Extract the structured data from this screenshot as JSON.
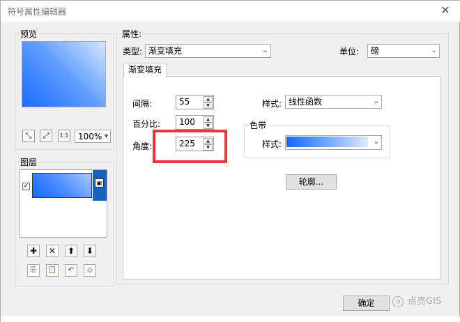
{
  "window": {
    "title": "符号属性编辑器",
    "close_glyph": "✕"
  },
  "preview": {
    "label": "预览",
    "zoom_value": "100%",
    "zoom_arrow": "▾",
    "toolbar": {
      "fit_glyph": "⤡",
      "expand_glyph": "⤢",
      "actual_glyph": "1:1"
    }
  },
  "layers": {
    "label": "图层",
    "check_glyph": "✓",
    "lock_glyph": "▣",
    "buttons": {
      "add_glyph": "✚",
      "remove_glyph": "✕",
      "up_glyph": "⬆",
      "down_glyph": "⬇",
      "copy_glyph": "⎘",
      "paste_glyph": "📋",
      "reset_glyph": "↶",
      "tag_glyph": "◇"
    }
  },
  "properties": {
    "label": "属性:",
    "type_label": "类型:",
    "type_value": "渐变填充",
    "unit_label": "单位:",
    "unit_value": "磅",
    "arrow_glyph": "⌄"
  },
  "tab": {
    "label": "渐变填充"
  },
  "gradient": {
    "interval_label": "间隔:",
    "interval_value": "55",
    "percent_label": "百分比:",
    "percent_value": "100",
    "angle_label": "角度:",
    "angle_value": "225",
    "spin_up_glyph": "▲",
    "spin_down_glyph": "▼",
    "style_label": "样式:",
    "style_value": "线性函数",
    "colorband_title": "色带",
    "colorband_style_label": "样式:",
    "outline_button": "轮廓..."
  },
  "footer": {
    "ok_button": "确定",
    "watermark_text": "点亮GIS",
    "watermark_glyph": "◔"
  },
  "colors": {
    "accent": "#1565c0",
    "highlight": "#e43a3a",
    "gradient_start": "#1766ff",
    "gradient_end": "#dbe9ff"
  }
}
